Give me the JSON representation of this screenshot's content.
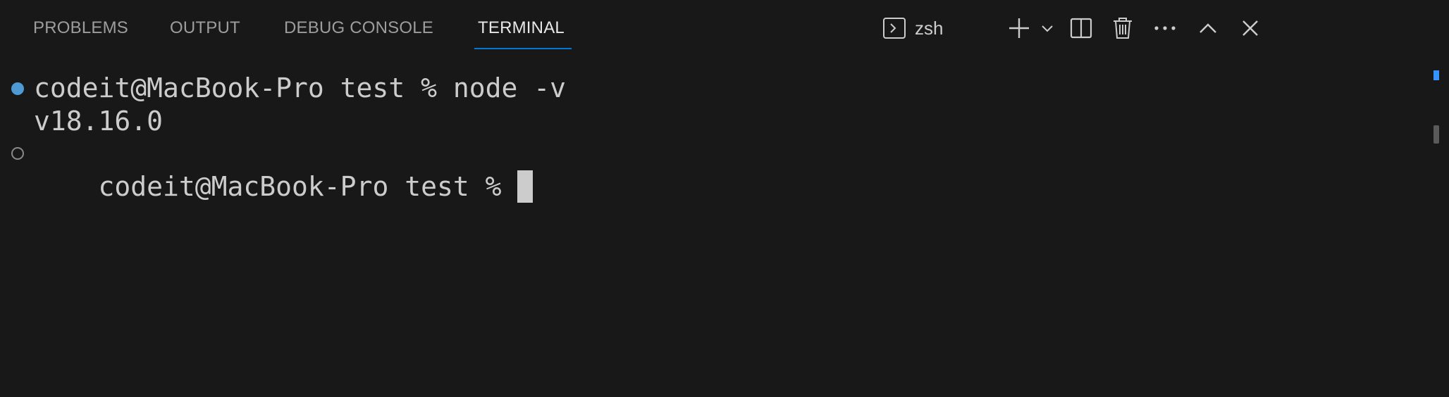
{
  "panel": {
    "tabs": [
      {
        "label": "PROBLEMS",
        "active": false
      },
      {
        "label": "OUTPUT",
        "active": false
      },
      {
        "label": "DEBUG CONSOLE",
        "active": false
      },
      {
        "label": "TERMINAL",
        "active": true
      }
    ],
    "active_color": "#0078d4",
    "actions": {
      "shell_icon": "terminal-icon",
      "shell_label": "zsh",
      "new_terminal_icon": "plus-icon",
      "launch_profile_icon": "chevron-down-icon",
      "split_icon": "split-editor-icon",
      "kill_icon": "trash-icon",
      "more_icon": "ellipsis-icon",
      "maximize_icon": "chevron-up-icon",
      "close_icon": "close-icon"
    }
  },
  "terminal": {
    "lines": [
      {
        "text": "codeit@MacBook-Pro test % node -v",
        "decoration": "success"
      },
      {
        "text": "v18.16.0",
        "decoration": "none"
      },
      {
        "text": "codeit@MacBook-Pro test % ",
        "decoration": "empty"
      }
    ],
    "cursor": "block"
  }
}
